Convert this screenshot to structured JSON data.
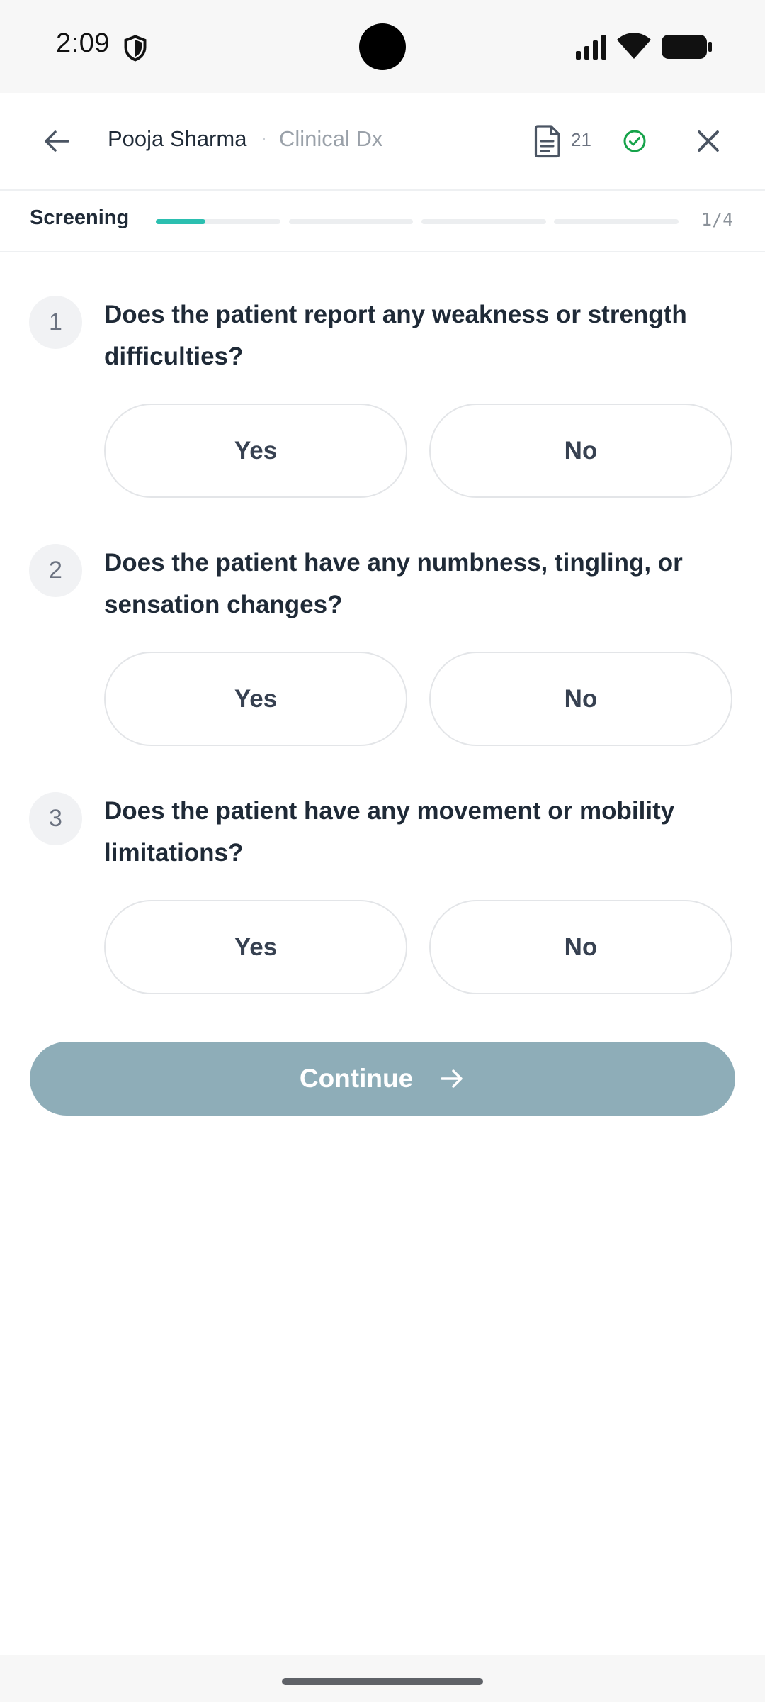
{
  "status_bar": {
    "time": "2:09"
  },
  "header": {
    "patient_name": "Pooja Sharma",
    "separator": "·",
    "context": "Clinical Dx",
    "document_count": "21"
  },
  "progress": {
    "step_label": "Screening",
    "step_count": "1/4",
    "segments": 4,
    "current_segment_fraction": 0.4,
    "accent_color": "#2bbfb0"
  },
  "questions": [
    {
      "number": "1",
      "text": "Does the patient report any weakness or strength difficulties?",
      "yes_label": "Yes",
      "no_label": "No"
    },
    {
      "number": "2",
      "text": "Does the patient have any numbness, tingling, or sensation changes?",
      "yes_label": "Yes",
      "no_label": "No"
    },
    {
      "number": "3",
      "text": "Does the patient have any movement or mobility limitations?",
      "yes_label": "Yes",
      "no_label": "No"
    }
  ],
  "continue_button": {
    "label": "Continue",
    "disabled_color": "#8eadb8"
  }
}
